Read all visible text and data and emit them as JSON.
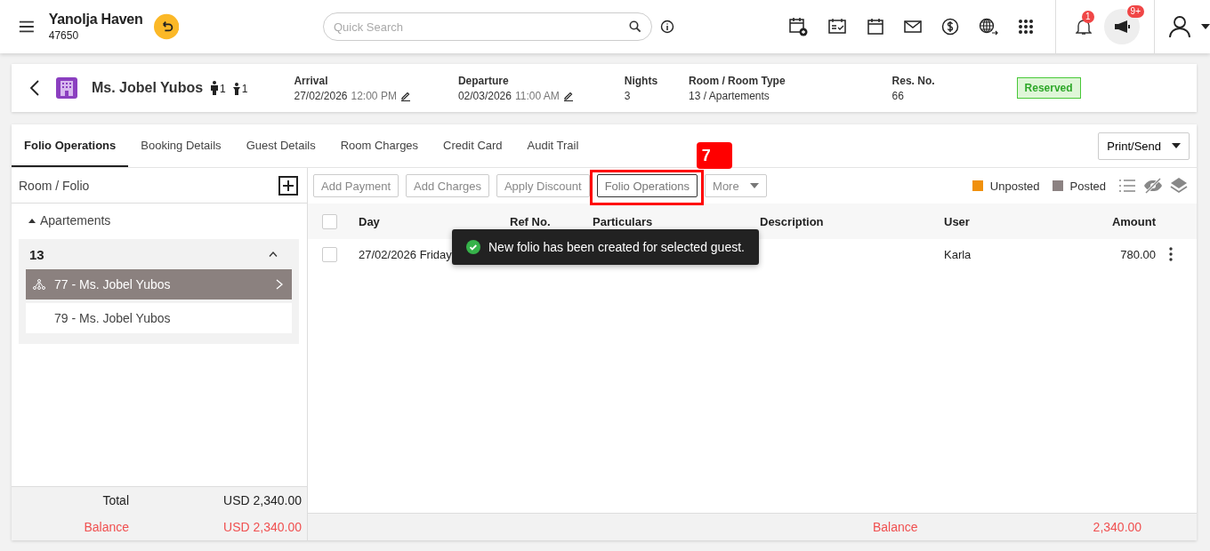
{
  "topbar": {
    "hotel": "Yanolja Haven",
    "code": "47650",
    "search": {
      "placeholder": "Quick Search"
    },
    "notifications": "1",
    "announcements": "9+"
  },
  "reservation": {
    "guest": "Ms. Jobel Yubos",
    "adults": "1",
    "children": "1",
    "fields": [
      {
        "label": "Arrival",
        "date": "27/02/2026",
        "time": "12:00 PM",
        "editable": true
      },
      {
        "label": "Departure",
        "date": "02/03/2026",
        "time": "11:00 AM",
        "editable": true
      },
      {
        "label": "Nights",
        "date": "3",
        "editable": false
      },
      {
        "label": "Room / Room Type",
        "date": "13 / Apartements",
        "editable": false
      },
      {
        "label": "Res. No.",
        "date": "66",
        "editable": false
      }
    ],
    "status": "Reserved"
  },
  "tabs": [
    {
      "label": "Folio Operations",
      "selected": true
    },
    {
      "label": "Booking Details",
      "selected": false
    },
    {
      "label": "Guest Details",
      "selected": false
    },
    {
      "label": "Room Charges",
      "selected": false
    },
    {
      "label": "Credit Card",
      "selected": false
    },
    {
      "label": "Audit Trail",
      "selected": false
    }
  ],
  "print_button": "Print/Send",
  "sidebar": {
    "title": "Room / Folio",
    "group": "Apartements",
    "room": "13",
    "folios": [
      {
        "label": "77 - Ms. Jobel Yubos",
        "selected": true
      },
      {
        "label": "79 - Ms. Jobel Yubos",
        "selected": false
      }
    ],
    "total_label": "Total",
    "total": "USD 2,340.00",
    "balance_label": "Balance",
    "balance": "USD 2,340.00"
  },
  "actions": [
    {
      "label": "Add Payment",
      "highlighted": false,
      "dropdown": false
    },
    {
      "label": "Add Charges",
      "highlighted": false,
      "dropdown": false
    },
    {
      "label": "Apply Discount",
      "highlighted": false,
      "dropdown": false
    },
    {
      "label": "Folio Operations",
      "highlighted": true,
      "dropdown": false
    },
    {
      "label": "More",
      "highlighted": false,
      "dropdown": true
    }
  ],
  "step_marker": "7",
  "legend": [
    {
      "label": "Unposted",
      "color": "#f0900c"
    },
    {
      "label": "Posted",
      "color": "#8c8282"
    }
  ],
  "table": {
    "columns": [
      "Day",
      "Ref No.",
      "Particulars",
      "Description",
      "User",
      "Amount"
    ],
    "all_checked": false,
    "rows": [
      {
        "day": "27/02/2026 Friday",
        "ref": "",
        "particulars": "",
        "description": "",
        "user": "Karla",
        "amount": "780.00",
        "checked": false
      }
    ]
  },
  "toast": "New folio has been created for selected guest.",
  "footer": {
    "balance_label": "Balance",
    "balance": "2,340.00"
  }
}
